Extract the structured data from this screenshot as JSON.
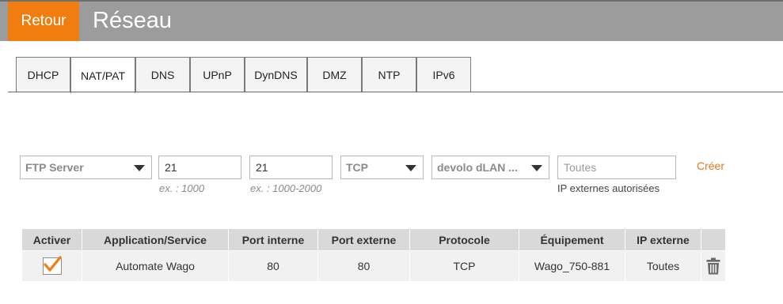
{
  "header": {
    "back_label": "Retour",
    "title": "Réseau"
  },
  "tabs": [
    {
      "label": "DHCP",
      "active": false
    },
    {
      "label": "NAT/PAT",
      "active": true
    },
    {
      "label": "DNS",
      "active": false
    },
    {
      "label": "UPnP",
      "active": false
    },
    {
      "label": "DynDNS",
      "active": false
    },
    {
      "label": "DMZ",
      "active": false
    },
    {
      "label": "NTP",
      "active": false
    },
    {
      "label": "IPv6",
      "active": false
    }
  ],
  "form": {
    "service_select": "FTP Server",
    "internal_port_value": "21",
    "internal_port_hint": "ex. : 1000",
    "external_port_value": "21",
    "external_port_hint": "ex. : 1000-2000",
    "protocol_select": "TCP",
    "device_select": "devolo dLAN ...",
    "ip_placeholder": "Toutes",
    "ip_hint": "IP externes autorisées",
    "create_label": "Créer"
  },
  "table": {
    "headers": [
      "Activer",
      "Application/Service",
      "Port interne",
      "Port externe",
      "Protocole",
      "Équipement",
      "IP externe"
    ],
    "rows": [
      {
        "enabled": true,
        "service": "Automate Wago",
        "internal_port": "80",
        "external_port": "80",
        "protocol": "TCP",
        "device": "Wago_750-881",
        "ip": "Toutes"
      }
    ]
  },
  "colors": {
    "accent": "#ef7d10",
    "header_bg": "#9c9c9c",
    "create_link": "#e07a20"
  }
}
